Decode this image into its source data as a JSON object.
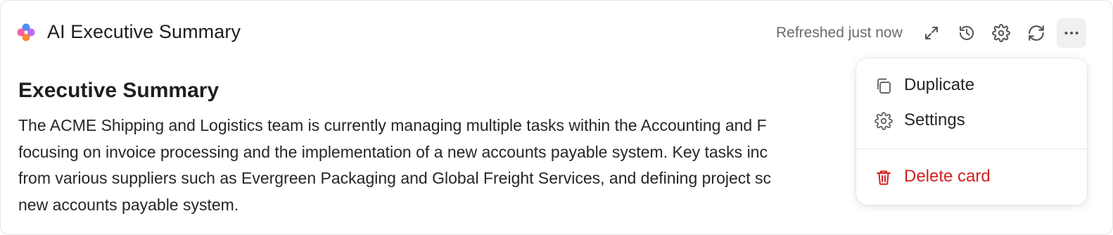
{
  "header": {
    "title": "AI Executive Summary",
    "status": "Refreshed just now",
    "icons": [
      "expand-icon",
      "history-icon",
      "gear-icon",
      "refresh-icon",
      "more-icon"
    ]
  },
  "summary": {
    "heading": "Executive Summary",
    "lines": [
      "The ACME Shipping and Logistics team is currently managing multiple tasks within the Accounting and F",
      "focusing on invoice processing and the implementation of a new accounts payable system. Key tasks inc",
      "from various suppliers such as Evergreen Packaging and Global Freight Services, and defining project sc",
      "new accounts payable system."
    ]
  },
  "menu": {
    "items": [
      {
        "label": "Duplicate",
        "icon": "copy-icon"
      },
      {
        "label": "Settings",
        "icon": "gear-icon"
      },
      {
        "label": "Delete card",
        "icon": "trash-icon",
        "danger": true
      }
    ]
  },
  "colors": {
    "danger": "#d32020",
    "text": "#262626",
    "muted": "#6b6b6b",
    "active_bg": "#f0f0f0"
  }
}
